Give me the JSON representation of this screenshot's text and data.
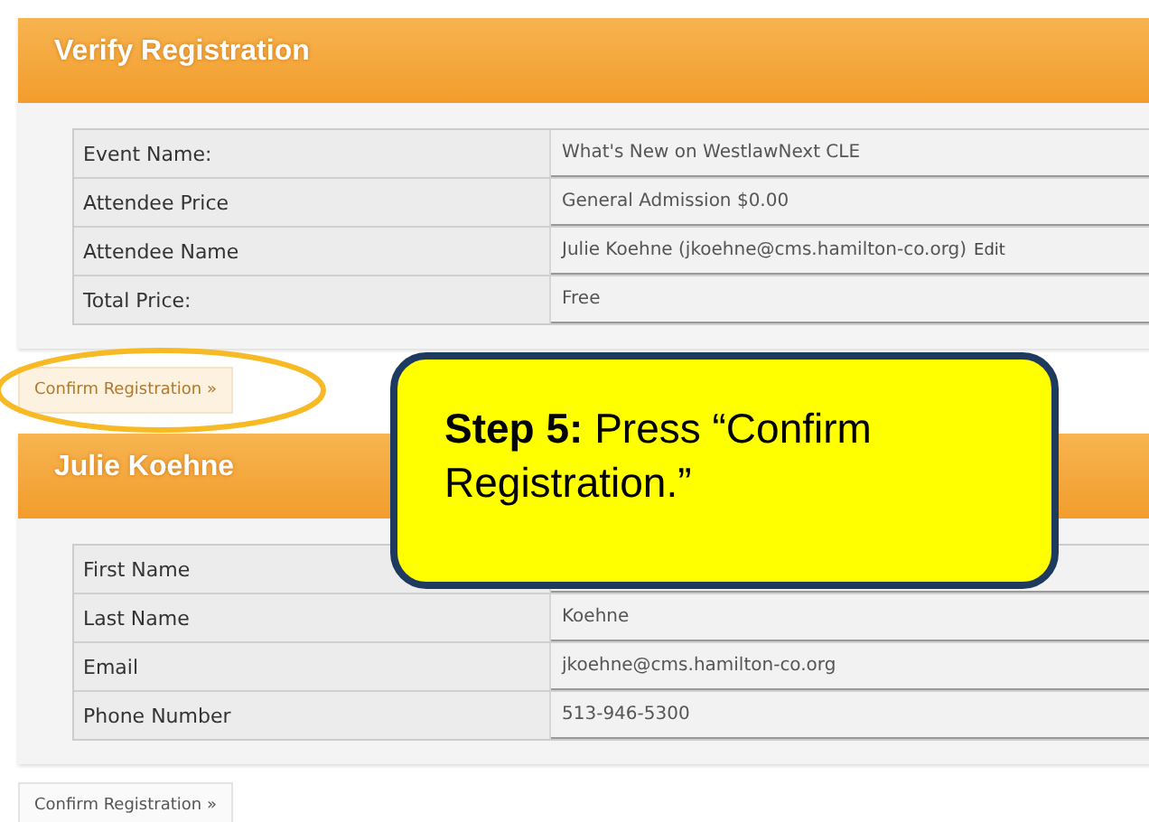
{
  "sections": [
    {
      "title": "Verify Registration",
      "rows": [
        {
          "label": "Event Name:",
          "value": "What's New on WestlawNext CLE"
        },
        {
          "label": "Attendee Price",
          "value": "General Admission $0.00"
        },
        {
          "label": "Attendee Name",
          "value": "Julie Koehne (jkoehne@cms.hamilton-co.org)",
          "link": "Edit"
        },
        {
          "label": "Total Price:",
          "value": "Free"
        }
      ],
      "button": {
        "label": "Confirm Registration »",
        "highlighted": true
      }
    },
    {
      "title": "Julie Koehne",
      "rows": [
        {
          "label": "First Name"
        },
        {
          "label": "Last Name",
          "value": "Koehne"
        },
        {
          "label": "Email",
          "value": "jkoehne@cms.hamilton-co.org"
        },
        {
          "label": "Phone Number",
          "value": "513-946-5300"
        }
      ],
      "button": {
        "label": "Confirm Registration »",
        "highlighted": false
      }
    }
  ],
  "callout": {
    "text": "**Step 5:** Press “Confirm Registration.”"
  }
}
